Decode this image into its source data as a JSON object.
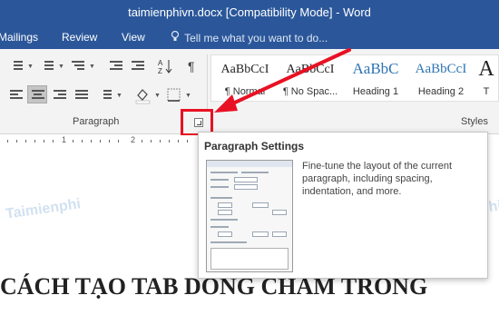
{
  "window": {
    "title": "taimienphivn.docx [Compatibility Mode] - Word"
  },
  "tabs": {
    "mailings": "Mailings",
    "review": "Review",
    "view": "View"
  },
  "tell_me": {
    "placeholder": "Tell me what you want to do..."
  },
  "ribbon": {
    "paragraph_group_label": "Paragraph",
    "styles_group_label": "Styles",
    "styles": [
      {
        "sample": "AaBbCcI",
        "name": "¶ Normal"
      },
      {
        "sample": "AaBbCcI",
        "name": "¶ No Spac..."
      },
      {
        "sample": "AaBbC",
        "name": "Heading 1"
      },
      {
        "sample": "AaBbCcI",
        "name": "Heading 2"
      },
      {
        "sample": "A",
        "name": "T"
      }
    ]
  },
  "ruler": {
    "numbers": [
      "1",
      "2"
    ]
  },
  "tooltip": {
    "title": "Paragraph Settings",
    "description": "Fine-tune the layout of the current paragraph, including spacing, indentation, and more."
  },
  "document": {
    "heading": "CÁCH TẠO TAB DÒNG CHẤM TRONG"
  },
  "colors": {
    "title_bar": "#2b579a",
    "highlight_box": "#e81123",
    "heading_style": "#2e74b5"
  },
  "watermark": {
    "text": "Taimienphi"
  }
}
